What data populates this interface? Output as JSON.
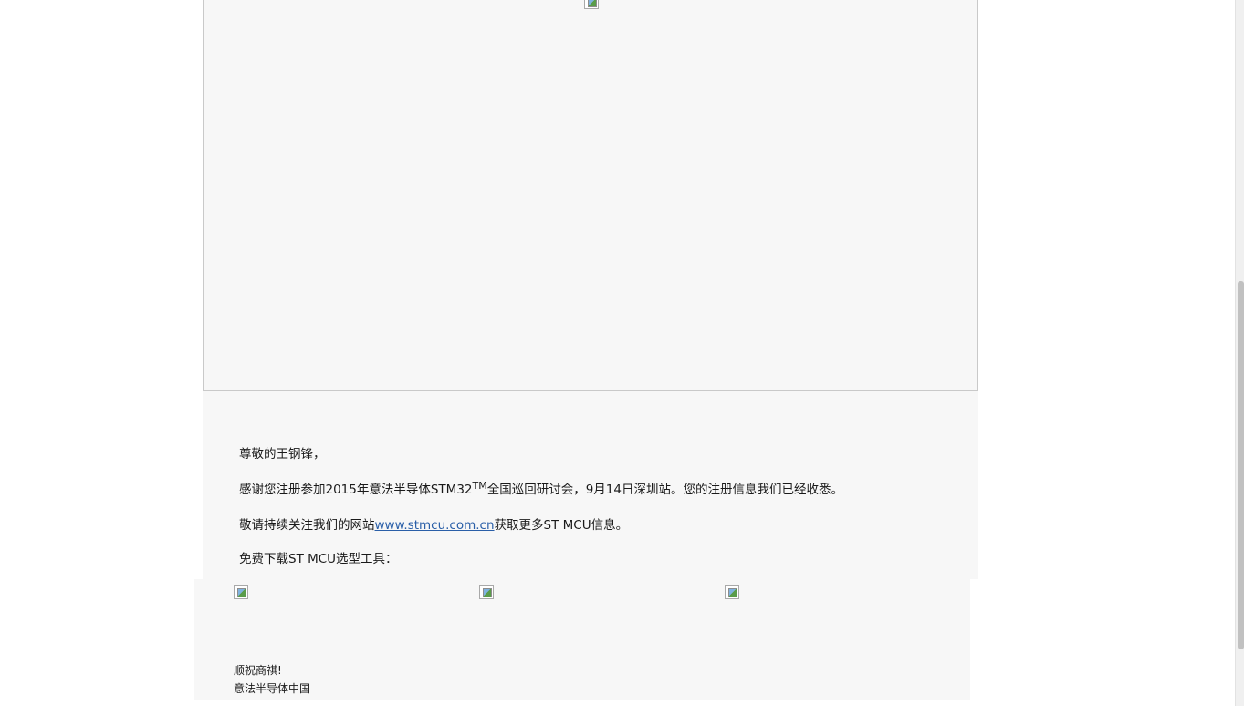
{
  "email": {
    "greeting": "尊敬的王钢锋，",
    "thanks_before": "感谢您注册参加2015年意法半导体STM32",
    "thanks_sup": "TM",
    "thanks_after": "全国巡回研讨会，9月14日深圳站。您的注册信息我们已经收悉。",
    "follow_before": "敬请持续关注我们的网站",
    "follow_link": "www.stmcu.com.cn",
    "follow_after": "获取更多ST MCU信息。",
    "download": "免费下载ST MCU选型工具：",
    "signature_line1": "顺祝商祺!",
    "signature_line2": "意法半导体中国"
  },
  "icons": {
    "broken_image": "broken-image-icon"
  }
}
